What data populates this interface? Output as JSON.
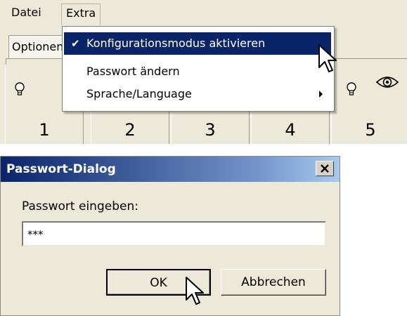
{
  "menubar": {
    "items": [
      {
        "label": "Datei"
      },
      {
        "label": "Extra"
      }
    ]
  },
  "tabs": {
    "options_label": "Optionen"
  },
  "dropdown": {
    "items": [
      {
        "label": "Konfigurationsmodus aktivieren",
        "checked": true,
        "highlighted": true,
        "submenu": false
      },
      {
        "label": "Passwort ändern",
        "checked": false,
        "highlighted": false,
        "submenu": false
      },
      {
        "label": "Sprache/Language",
        "checked": false,
        "highlighted": false,
        "submenu": true
      }
    ]
  },
  "tiles": [
    {
      "number": "1"
    },
    {
      "number": "2"
    },
    {
      "number": "3"
    },
    {
      "number": "4"
    },
    {
      "number": "5"
    }
  ],
  "dialog": {
    "title": "Passwort-Dialog",
    "prompt": "Passwort eingeben:",
    "password_value": "***",
    "ok_label": "OK",
    "cancel_label": "Abbrechen"
  },
  "colors": {
    "highlight": "#0a246a",
    "titlebar_start": "#0a246a",
    "titlebar_end": "#a6caf0",
    "window_bg": "#ece9d8"
  },
  "icons": [
    "bulb-icon",
    "eye-icon",
    "checkmark-icon",
    "submenu-arrow-icon",
    "close-icon",
    "cursor-arrow-icon"
  ]
}
